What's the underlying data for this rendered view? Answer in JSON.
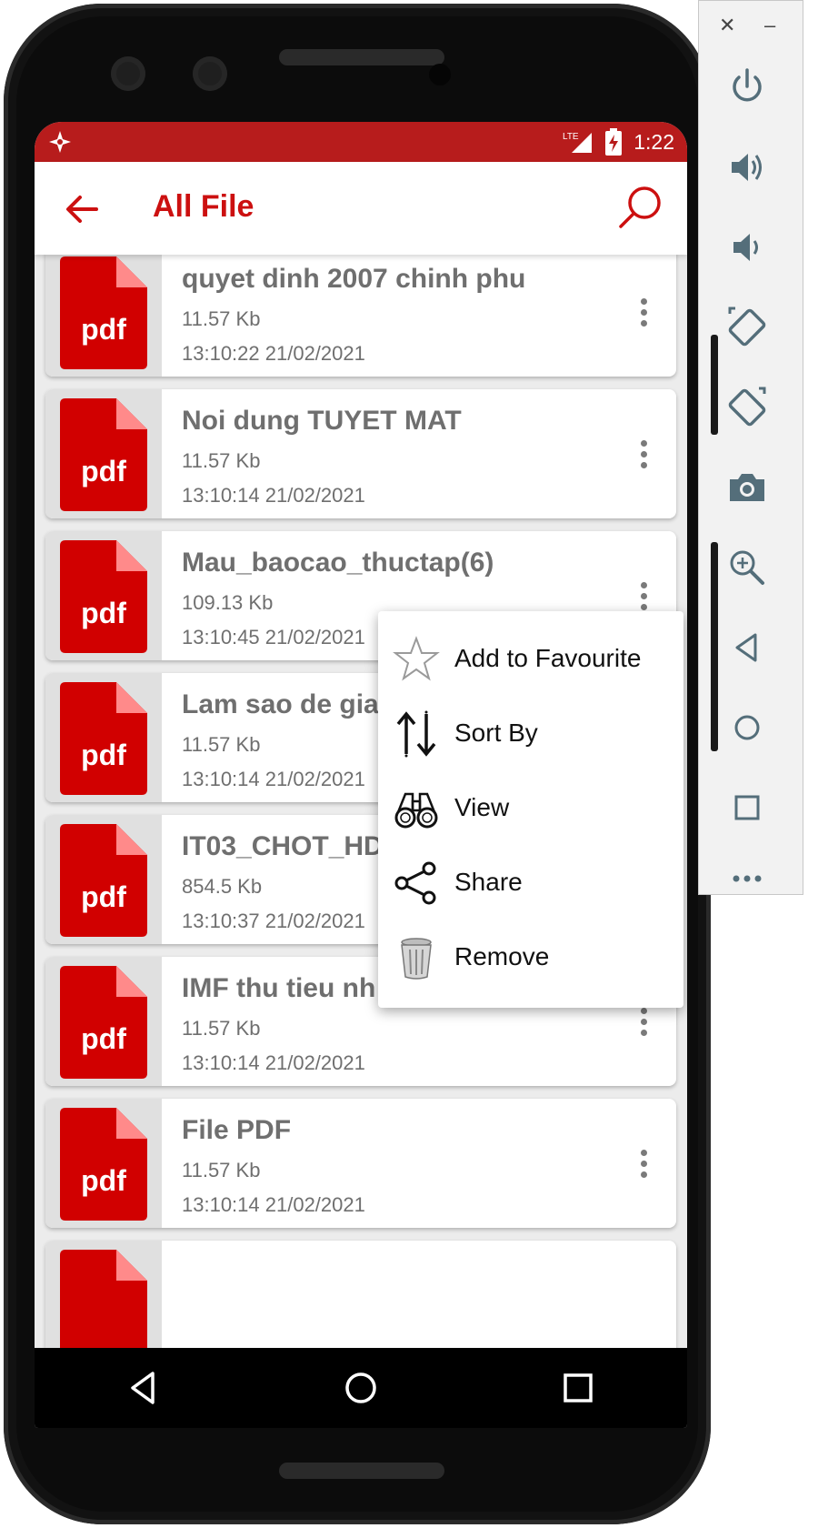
{
  "status_bar": {
    "network": "LTE",
    "time": "1:22"
  },
  "app_bar": {
    "title": "All File"
  },
  "files": [
    {
      "name": "quyet dinh 2007 chinh phu",
      "size": "11.57 Kb",
      "date": "13:10:22 21/02/2021",
      "type": "pdf"
    },
    {
      "name": "Noi dung TUYET MAT",
      "size": "11.57 Kb",
      "date": "13:10:14 21/02/2021",
      "type": "pdf"
    },
    {
      "name": "Mau_baocao_thuctap(6)",
      "size": "109.13 Kb",
      "date": "13:10:45 21/02/2021",
      "type": "pdf"
    },
    {
      "name": "Lam sao de gia",
      "size": "11.57 Kb",
      "date": "13:10:14 21/02/2021",
      "type": "pdf"
    },
    {
      "name": "IT03_CHOT_HD",
      "size": "854.5 Kb",
      "date": "13:10:37 21/02/2021",
      "type": "pdf"
    },
    {
      "name": "IMF thu tieu nh",
      "size": "11.57 Kb",
      "date": "13:10:14 21/02/2021",
      "type": "pdf"
    },
    {
      "name": "File PDF",
      "size": "11.57 Kb",
      "date": "13:10:14 21/02/2021",
      "type": "pdf"
    }
  ],
  "context_menu": {
    "items": [
      {
        "label": "Add to Favourite",
        "icon": "star-outline-icon"
      },
      {
        "label": "Sort By",
        "icon": "sort-arrows-icon"
      },
      {
        "label": "View",
        "icon": "binoculars-icon"
      },
      {
        "label": "Share",
        "icon": "share-icon"
      },
      {
        "label": "Remove",
        "icon": "trash-icon"
      }
    ]
  },
  "colors": {
    "status_bar": "#b71c1c",
    "accent": "#cc1010",
    "pdf_red": "#d10000",
    "text_gray": "#6f6f6f"
  }
}
